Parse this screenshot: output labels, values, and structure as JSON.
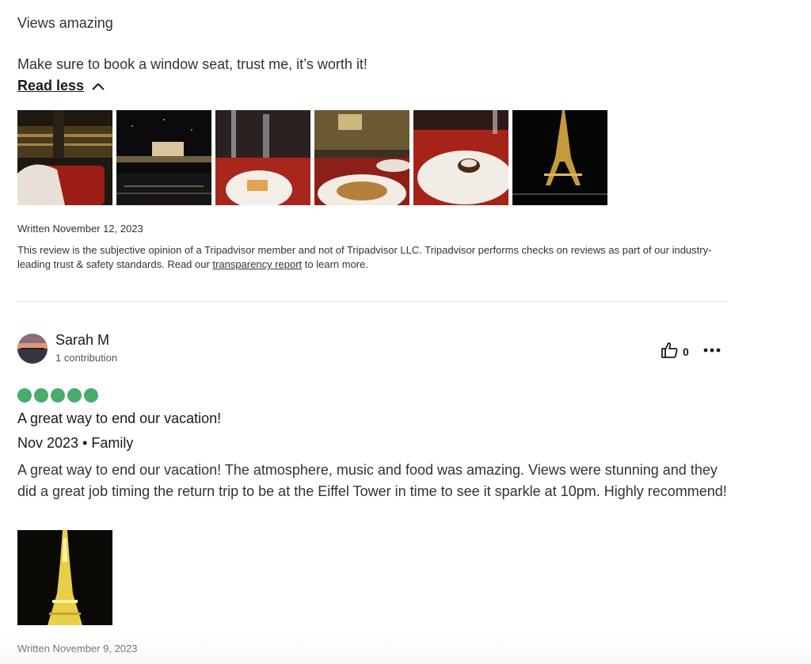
{
  "review1": {
    "text_line1": "Views amazing",
    "text_line2": "Make sure to book a window seat, trust me, it’s worth it!",
    "read_less": "Read less",
    "written": "Written November 12, 2023",
    "disclaimer_before": "This review is the subjective opinion of a Tripadvisor member and not of Tripadvisor LLC. Tripadvisor performs checks on reviews as part of our industry-leading trust & safety standards. Read our ",
    "disclaimer_link": "transparency report",
    "disclaimer_after": " to learn more.",
    "photos": [
      "champagne-bucket-photo",
      "night-river-building-photo",
      "dessert-cake-photo",
      "table-dinner-photo",
      "chocolate-dessert-plate-photo",
      "eiffel-tower-night-photo"
    ]
  },
  "review2": {
    "author": "Sarah M",
    "contributions": "1 contribution",
    "helpful_count": "0",
    "rating": 5,
    "title": "A great way to end our vacation!",
    "meta": "Nov 2023 • Family",
    "body": "A great way to end our vacation! The atmosphere, music and food was amazing. Views were stunning and they did a great job timing the return trip to be at the Eiffel Tower in time to see it sparkle at 10pm. Highly recommend!",
    "written": "Written November 9, 2023",
    "photos": [
      "eiffel-tower-sparkle-photo"
    ]
  },
  "colors": {
    "bubble": "#4aab6f",
    "divider": "#e0e0e0",
    "text": "#333333"
  }
}
